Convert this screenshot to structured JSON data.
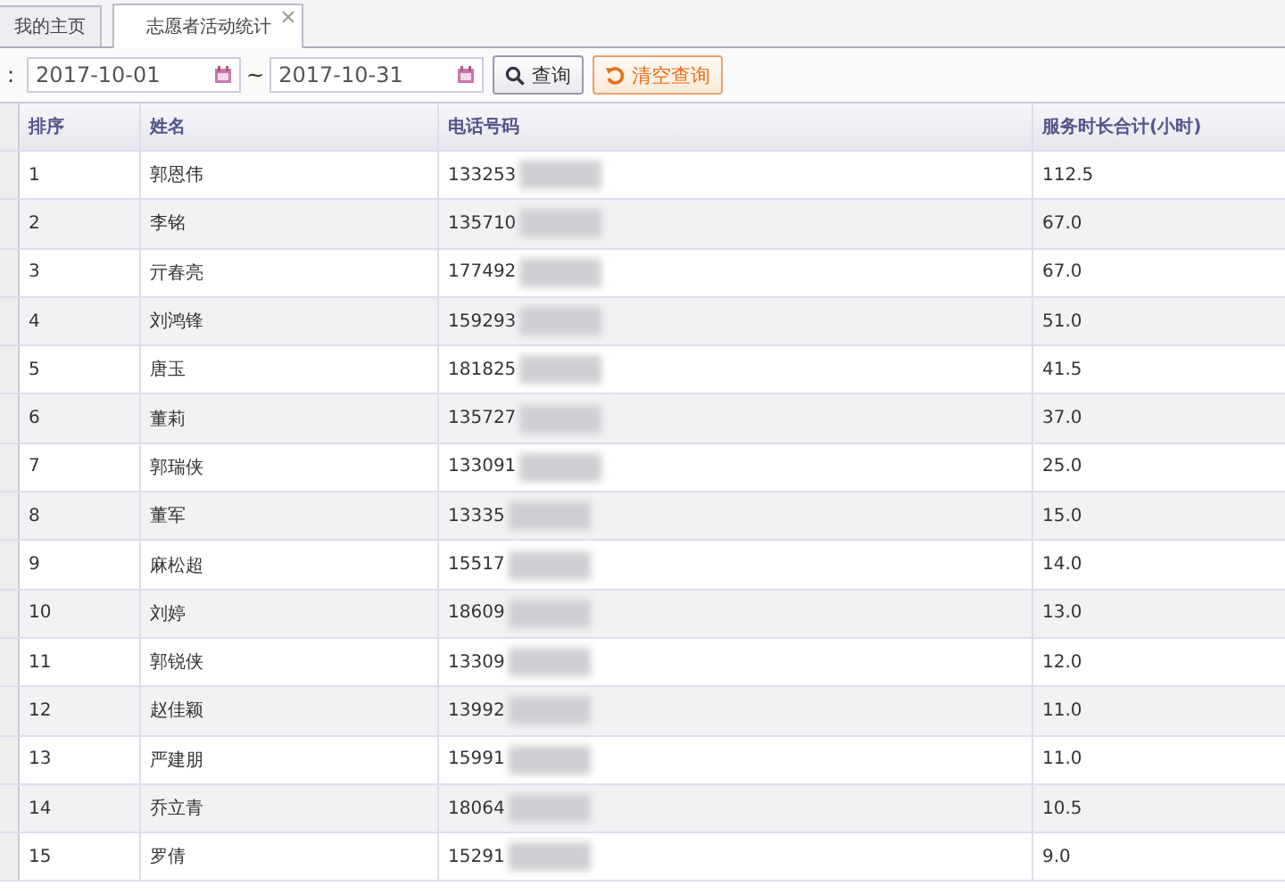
{
  "tabs": [
    {
      "label": "我的主页",
      "selected": false,
      "closable": false
    },
    {
      "label": "志愿者活动统计",
      "selected": true,
      "closable": true
    }
  ],
  "toolbar": {
    "label": ":",
    "start_date": "2017-10-01",
    "end_date": "2017-10-31",
    "separator": "~",
    "search_button": "查询",
    "clear_button": "清空查询"
  },
  "table": {
    "columns": [
      "排序",
      "姓名",
      "电话号码",
      "服务时长合计(小时)"
    ],
    "rows": [
      [
        "1",
        "郭恩伟",
        "133253",
        "112.5"
      ],
      [
        "2",
        "李铭",
        "135710",
        "67.0"
      ],
      [
        "3",
        "亓春亮",
        "177492",
        "67.0"
      ],
      [
        "4",
        "刘鸿锋",
        "159293",
        "51.0"
      ],
      [
        "5",
        "唐玉",
        "181825",
        "41.5"
      ],
      [
        "6",
        "董莉",
        "135727",
        "37.0"
      ],
      [
        "7",
        "郭瑞侠",
        "133091",
        "25.0"
      ],
      [
        "8",
        "董军",
        "13335",
        "15.0"
      ],
      [
        "9",
        "麻松超",
        "15517",
        "14.0"
      ],
      [
        "10",
        "刘婷",
        "18609",
        "13.0"
      ],
      [
        "11",
        "郭锐侠",
        "13309",
        "12.0"
      ],
      [
        "12",
        "赵佳颖",
        "13992",
        "11.0"
      ],
      [
        "13",
        "严建朋",
        "15991",
        "11.0"
      ],
      [
        "14",
        "乔立青",
        "18064",
        "10.5"
      ],
      [
        "15",
        "罗倩",
        "15291",
        "9.0"
      ]
    ]
  }
}
